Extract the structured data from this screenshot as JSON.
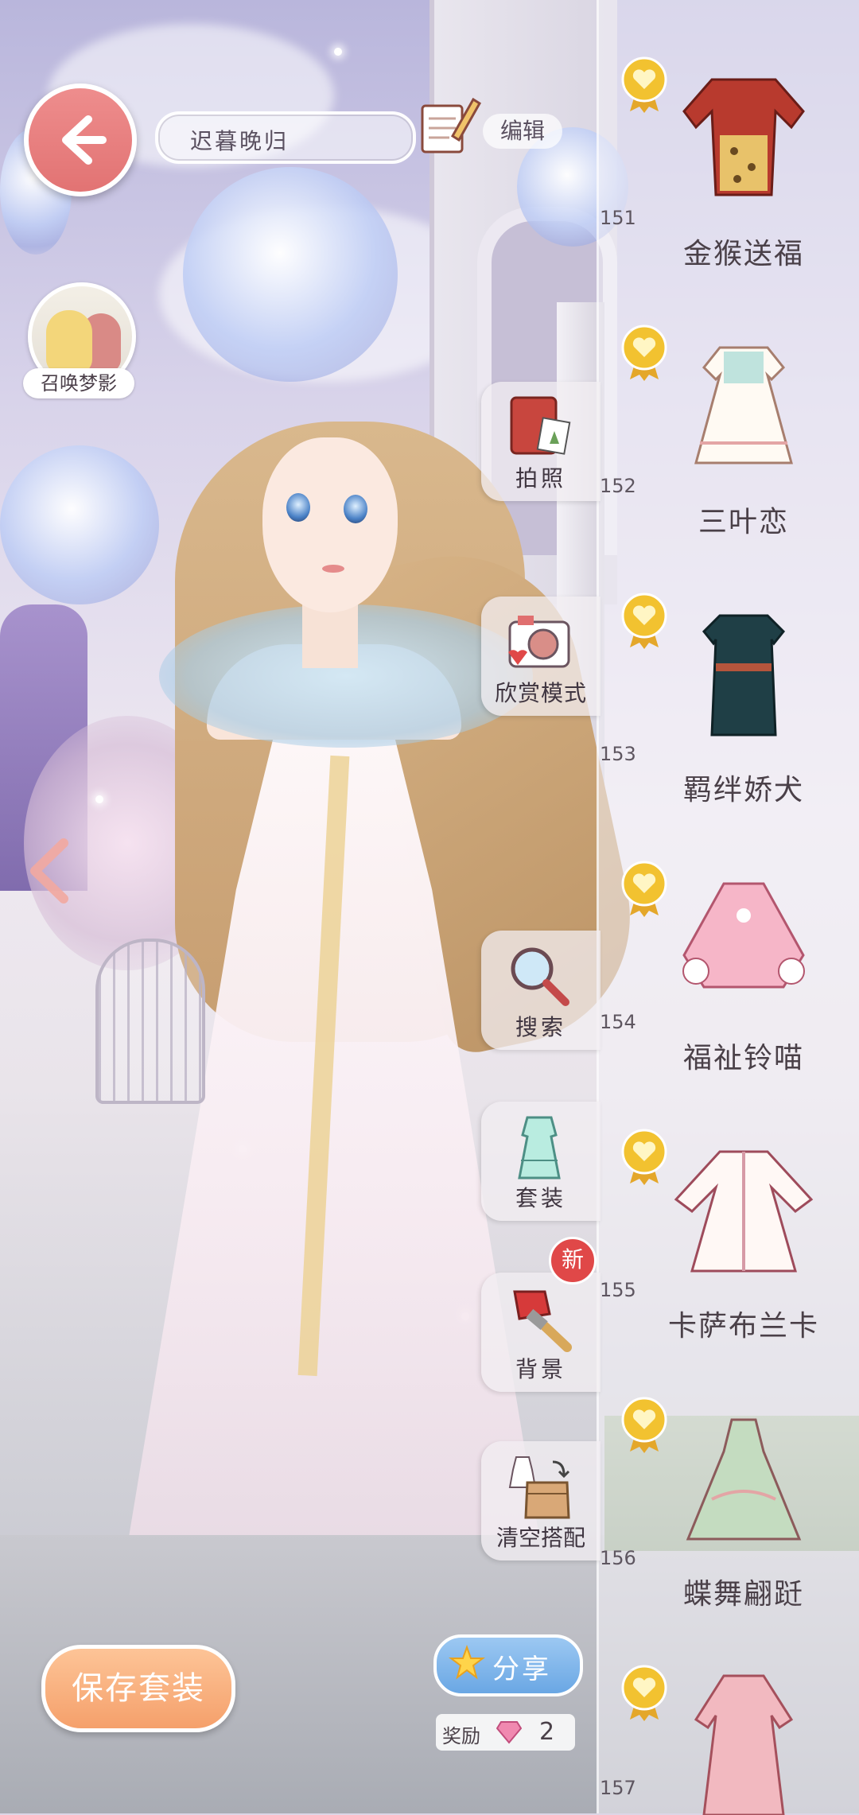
{
  "header": {
    "outfit_name": "迟暮晚归",
    "edit_label": "编辑"
  },
  "summon": {
    "label": "召唤梦影"
  },
  "side_menu": [
    {
      "label": "拍照",
      "icon": "photo-album-icon"
    },
    {
      "label": "欣赏模式",
      "icon": "camera-icon"
    },
    {
      "label": "搜索",
      "icon": "magnifier-icon"
    },
    {
      "label": "套装",
      "icon": "outfit-icon"
    },
    {
      "label": "背景",
      "icon": "paint-brush-icon"
    },
    {
      "label": "清空搭配",
      "icon": "clear-outfit-icon"
    }
  ],
  "new_badge": "新",
  "items": [
    {
      "number": "151",
      "name": "金猴送福"
    },
    {
      "number": "152",
      "name": "三叶恋"
    },
    {
      "number": "153",
      "name": "羁绊娇犬"
    },
    {
      "number": "154",
      "name": "福祉铃喵"
    },
    {
      "number": "155",
      "name": "卡萨布兰卡"
    },
    {
      "number": "156",
      "name": "蝶舞翩跹"
    },
    {
      "number": "157",
      "name": ""
    }
  ],
  "bottom": {
    "save_label": "保存套装",
    "share_label": "分享",
    "reward_label": "奖励",
    "reward_count": "2"
  },
  "colors": {
    "back_button": "#e27373",
    "save_button": "#f5a06b",
    "share_button": "#6aa7e4",
    "new_badge": "#e04848",
    "medal": "#f2c230"
  }
}
